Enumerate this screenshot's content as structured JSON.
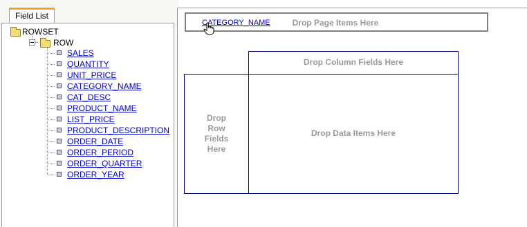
{
  "field_list": {
    "tab_label": "Field List",
    "root": {
      "label": "ROWSET",
      "icon": "folder-open-icon"
    },
    "row": {
      "label": "ROW",
      "icon": "folder-open-icon"
    },
    "fields": [
      "SALES",
      "QUANTITY",
      "UNIT_PRICE",
      "CATEGORY_NAME",
      "CAT_DESC",
      "PRODUCT_NAME",
      "LIST_PRICE",
      "PRODUCT_DESCRIPTION",
      "ORDER_DATE",
      "ORDER_PERIOD",
      "ORDER_QUARTER",
      "ORDER_YEAR"
    ]
  },
  "pivot": {
    "page_item": "CATEGORY_NAME",
    "page_hint": "Drop Page Items Here",
    "column_hint": "Drop Column Fields Here",
    "row_hint": [
      "Drop",
      "Row",
      "Fields",
      "Here"
    ],
    "data_hint": "Drop Data Items Here",
    "cursor": "hand-pointer-icon"
  },
  "colors": {
    "tab_accent": "#f1a330",
    "link": "#0000cc",
    "zone_border": "#000080",
    "hint_text": "#9a9a9a"
  }
}
